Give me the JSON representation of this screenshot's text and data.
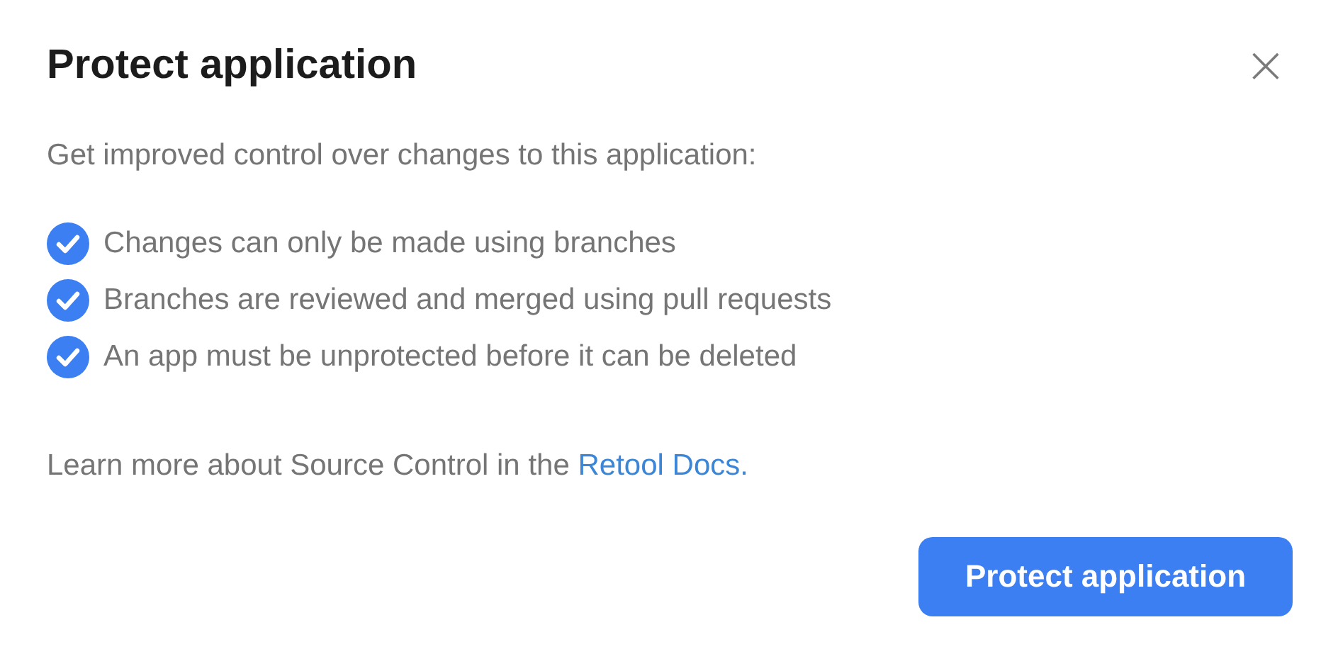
{
  "dialog": {
    "title": "Protect application",
    "close": "×",
    "intro": "Get improved control over changes to this application:",
    "benefits": [
      "Changes can only be made using branches",
      "Branches are reviewed and merged using pull requests",
      "An app must be unprotected before it can be deleted"
    ],
    "learn_more": {
      "text": "Learn more about Source Control in the",
      "link": "Retool Docs."
    },
    "primary_button": "Protect application"
  }
}
